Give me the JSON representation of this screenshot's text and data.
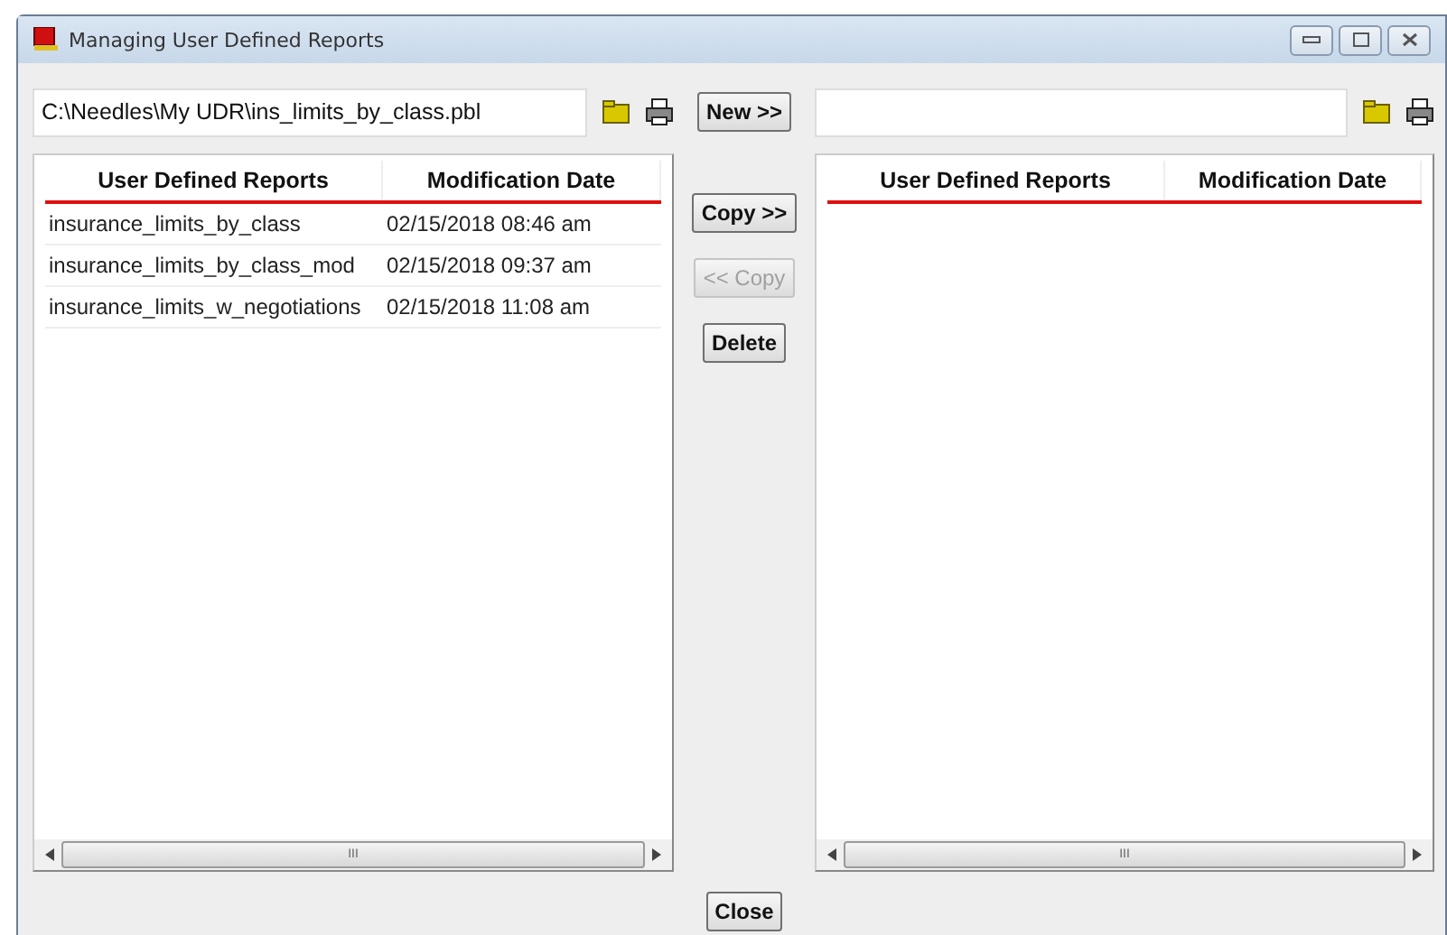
{
  "window": {
    "title": "Managing User Defined Reports"
  },
  "left": {
    "path": "C:\\Needles\\My UDR\\ins_limits_by_class.pbl",
    "columns": [
      "User Defined Reports",
      "Modification Date"
    ],
    "rows": [
      [
        "insurance_limits_by_class",
        "02/15/2018 08:46 am"
      ],
      [
        "insurance_limits_by_class_mod",
        "02/15/2018 09:37 am"
      ],
      [
        "insurance_limits_w_negotiations",
        "02/15/2018 11:08 am"
      ]
    ],
    "scrollbar_grip": "III"
  },
  "new_button": "New >>",
  "middle_buttons": [
    {
      "label": "Copy >>",
      "disabled": false
    },
    {
      "label": "<< Copy",
      "disabled": true
    },
    {
      "label": "Delete",
      "disabled": false
    }
  ],
  "right": {
    "columns": [
      "User Defined Reports",
      "Modification Date"
    ],
    "scrollbar_grip": "III"
  },
  "close_button": "Close"
}
